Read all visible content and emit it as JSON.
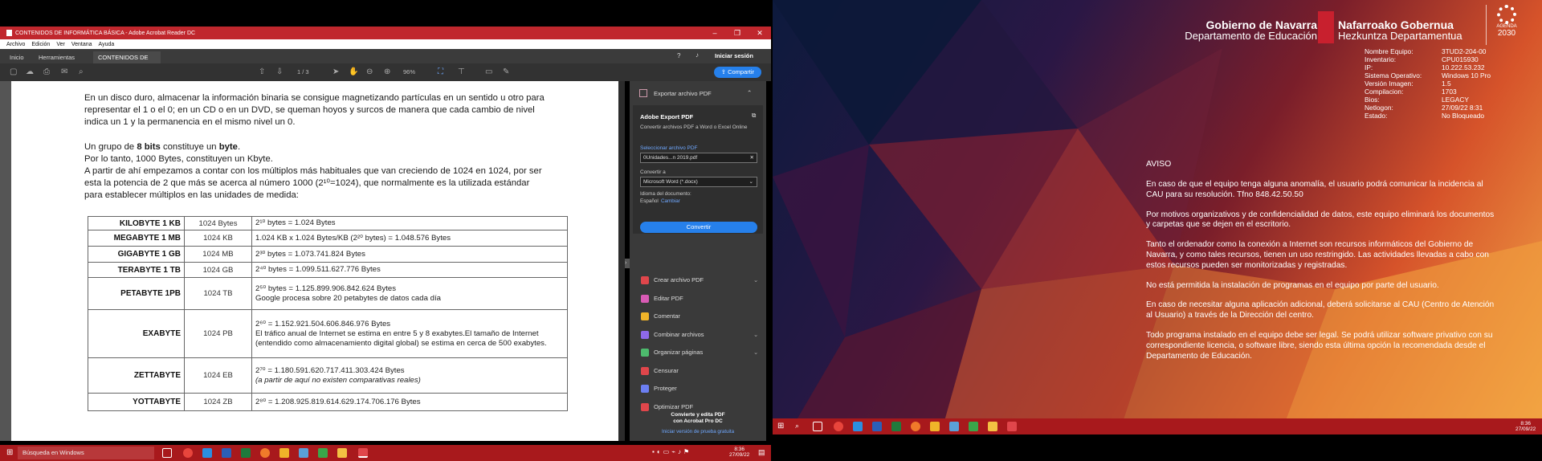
{
  "acrobat": {
    "window_title": "CONTENIDOS DE INFORMÁTICA BÁSICA - Adobe Acrobat Reader DC",
    "window_controls": [
      "–",
      "❐",
      "✕"
    ],
    "menu": [
      "Archivo",
      "Edición",
      "Ver",
      "Ventana",
      "Ayuda"
    ],
    "tabs": [
      "Inicio",
      "Herramientas",
      "CONTENIDOS DE I...",
      "✕"
    ],
    "signin": "Iniciar sesión",
    "share": "Compartir",
    "page_indicator": "1 / 3",
    "zoom": "96%",
    "document": {
      "para1": "En un disco duro,  almacenar la información binaria se consigue magnetizando partículas en un sentido u otro para representar el 1 o el 0; en un CD o en un DVD, se queman hoyos y surcos de manera que cada cambio de nivel indica un 1 y la permanencia en el mismo nivel un 0.",
      "para2_pre": "Un grupo de ",
      "para2_bold1": "8 bits",
      "para2_mid": " constituye un ",
      "para2_bold2": "byte",
      "para2_end": ".",
      "para3": "Por lo tanto, 1000 Bytes, constituyen un Kbyte.",
      "para4": "A partir de ahí empezamos a contar con los múltiplos más habituales que van creciendo de 1024 en 1024, por ser esta la potencia de 2 que más se acerca al número 1000 (2¹⁰=1024), que normalmente es la utilizada estándar para establecer múltiplos en las unidades de medida:",
      "table": [
        {
          "name": "KILOBYTE   1 KB",
          "unit": "1024 Bytes",
          "value": "2¹⁰ bytes = 1.024  Bytes",
          "extra": ""
        },
        {
          "name": "MEGABYTE  1 MB",
          "unit": "1024 KB",
          "value": "1.024 KB x 1.024 Bytes/KB  (2²⁰ bytes) = 1.048.576  Bytes",
          "extra": ""
        },
        {
          "name": "GIGABYTE   1 GB",
          "unit": "1024 MB",
          "value": "2³⁰ bytes = 1.073.741.824  Bytes",
          "extra": ""
        },
        {
          "name": "TERABYTE   1 TB",
          "unit": "1024 GB",
          "value": "2⁴⁰ bytes = 1.099.511.627.776  Bytes",
          "extra": ""
        },
        {
          "name": "PETABYTE   1PB",
          "unit": "1024 TB",
          "value": "2⁵⁰ bytes = 1.125.899.906.842.624 Bytes",
          "extra": "Google procesa sobre 20 petabytes de datos cada día"
        },
        {
          "name": "EXABYTE",
          "unit": "1024 PB",
          "value": "2⁶⁰ = 1.152.921.504.606.846.976 Bytes",
          "extra": "El tráfico anual de Internet se estima en entre 5 y 8 exabytes.El tamaño de Internet (entendido como almacenamiento digital global) se estima en cerca de 500 exabytes."
        },
        {
          "name": "ZETTABYTE",
          "unit": "1024 EB",
          "value": "2⁷⁰ = 1.180.591.620.717.411.303.424 Bytes",
          "extra": "(a partir de aquí no existen comparativas reales)"
        },
        {
          "name": "YOTTABYTE",
          "unit": "1024 ZB",
          "value": "2⁸⁰ = 1.208.925.819.614.629.174.706.176 Bytes",
          "extra": ""
        }
      ]
    },
    "right_pane": {
      "export_header": "Exportar archivo PDF",
      "export_title": "Adobe Export PDF",
      "export_desc": "Convertir archivos PDF a Word o Excel Online",
      "select_label": "Seleccionar archivo PDF",
      "file_value": "0Unidades...n 2019.pdf",
      "convert_to_label": "Convertir a",
      "format_value": "Microsoft Word (*.docx)",
      "lang_label": "Idioma del documento:",
      "lang_value": "Español",
      "lang_change": "Cambiar",
      "convert_button": "Convertir",
      "tools": [
        {
          "label": "Crear archivo PDF",
          "chevron": true,
          "color": "#e0464b"
        },
        {
          "label": "Editar PDF",
          "chevron": false,
          "color": "#d95bb5"
        },
        {
          "label": "Comentar",
          "chevron": false,
          "color": "#f0b429"
        },
        {
          "label": "Combinar archivos",
          "chevron": true,
          "color": "#8e69e8"
        },
        {
          "label": "Organizar páginas",
          "chevron": true,
          "color": "#4dbb6d"
        },
        {
          "label": "Censurar",
          "chevron": false,
          "color": "#e0464b"
        },
        {
          "label": "Proteger",
          "chevron": false,
          "color": "#6c7ff2"
        },
        {
          "label": "Optimizar PDF",
          "chevron": false,
          "color": "#e0464b"
        }
      ],
      "promo": "Convierte y edita PDF\ncon Acrobat Pro DC",
      "trial": "Iniciar versión de prueba gratuita"
    }
  },
  "left_taskbar": {
    "search_placeholder": "Búsqueda en Windows",
    "clock_time": "8:36",
    "clock_date": "27/09/22"
  },
  "desktop": {
    "logo_es_title": "Gobierno de Navarra",
    "logo_es_sub": "Departamento de Educación",
    "logo_eu_title": "Nafarroako Gobernua",
    "logo_eu_sub": "Hezkuntza Departamentua",
    "agenda_label": "AGENDA",
    "agenda_year": "2030",
    "info": [
      {
        "key": "Nombre Equipo:",
        "value": "3TUD2-204-00"
      },
      {
        "key": "Inventario:",
        "value": "CPU015930"
      },
      {
        "key": "IP:",
        "value": "10.222.53.232"
      },
      {
        "key": "Sistema Operativo:",
        "value": "Windows 10 Pro"
      },
      {
        "key": "Versión Imagen:",
        "value": "1.5"
      },
      {
        "key": "Compilacion:",
        "value": "1703"
      },
      {
        "key": "Bios:",
        "value": "LEGACY"
      },
      {
        "key": "Netlogon:",
        "value": "27/09/22 8:31"
      },
      {
        "key": "Estado:",
        "value": "No Bloqueado"
      }
    ],
    "aviso_title": "AVISO",
    "aviso": [
      "En caso de que el equipo tenga alguna anomalía, el usuario podrá comunicar la incidencia al CAU para su resolución. Tfno 848.42.50.50",
      "Por motivos organizativos y de confidencialidad de datos, este equipo eliminará los documentos y carpetas que se dejen en el escritorio.",
      "Tanto el ordenador como la conexión a Internet son recursos informáticos del Gobierno de Navarra, y como tales recursos, tienen un uso restringido. Las actividades llevadas a cabo con estos recursos pueden ser monitorizadas y registradas.",
      "No está permitida la instalación de programas en el equipo por parte del usuario.",
      "En caso de necesitar alguna aplicación adicional, deberá solicitarse al CAU (Centro de Atención al Usuario) a través de la Dirección del centro.",
      "Todo programa instalado en el equipo debe ser legal. Se podrá utilizar software privativo con su correspondiente licencia, o software libre, siendo esta última opción la recomendada desde el Departamento de Educación."
    ]
  },
  "right_taskbar": {
    "clock_time": "8:36",
    "clock_date": "27/09/22"
  }
}
